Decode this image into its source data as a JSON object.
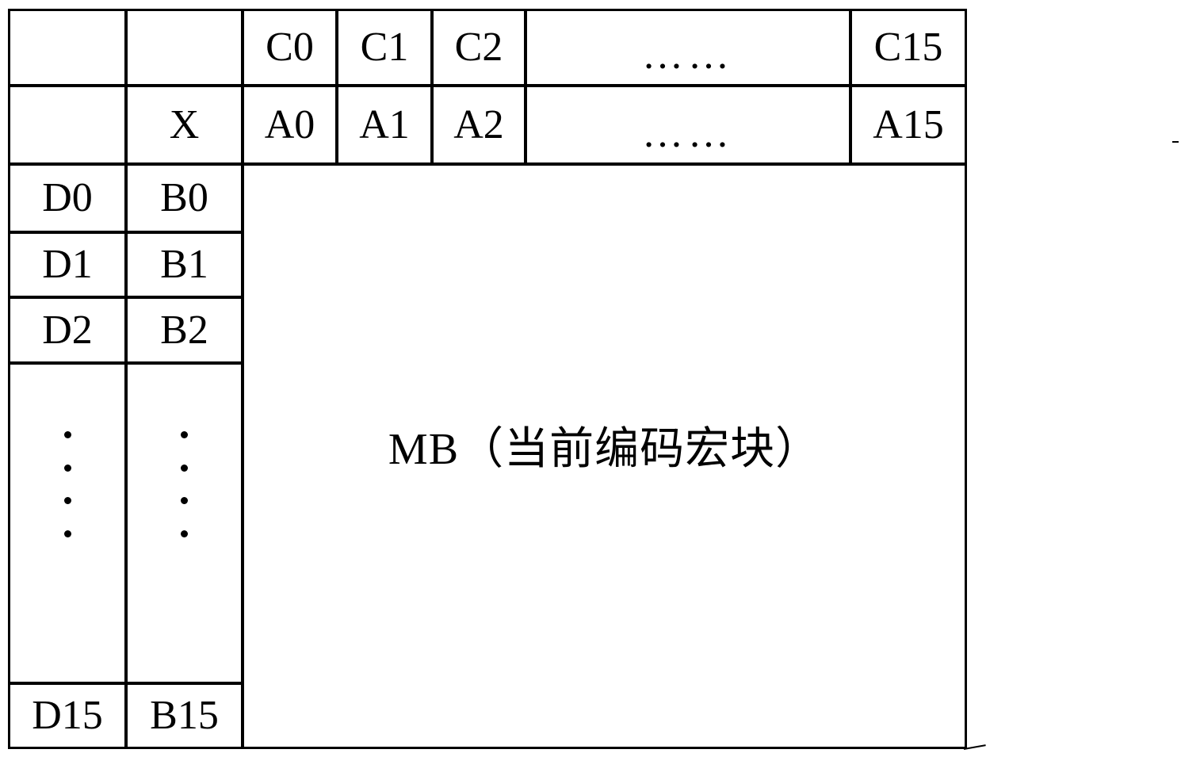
{
  "diagram": {
    "kind": "macroblock-neighbour-grid",
    "title_text": "MB（当前编码宏块）",
    "ellipsis_h": "……",
    "colors": {
      "line": "#000000",
      "background": "#ffffff",
      "text": "#000000"
    },
    "header_rows": [
      {
        "name": "row-c",
        "corner_a": "",
        "corner_b": "",
        "cells": [
          "C0",
          "C1",
          "C2"
        ],
        "ellipsis": "……",
        "last": "C15"
      },
      {
        "name": "row-a",
        "corner_a": "",
        "corner_b": "X",
        "cells": [
          "A0",
          "A1",
          "A2"
        ],
        "ellipsis": "……",
        "last": "A15"
      }
    ],
    "side_rows": [
      {
        "d": "D0",
        "b": "B0"
      },
      {
        "d": "D1",
        "b": "B1"
      },
      {
        "d": "D2",
        "b": "B2"
      },
      {
        "d": "",
        "b": ""
      },
      {
        "d": "D15",
        "b": "B15"
      }
    ],
    "vertical_dots_count": 4
  }
}
